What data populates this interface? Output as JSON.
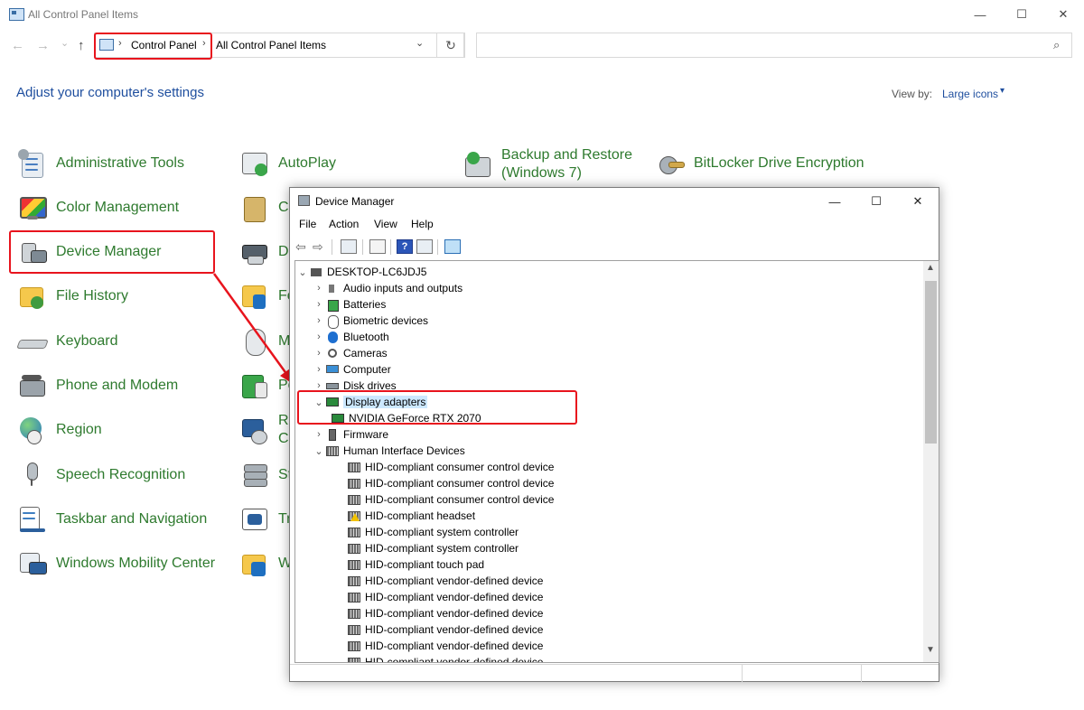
{
  "window": {
    "title": "All Control Panel Items",
    "minimize": "—",
    "maximize": "☐",
    "close": "✕"
  },
  "address": {
    "crumbs": [
      "Control Panel",
      "All Control Panel Items"
    ],
    "separator": "›",
    "dropdown": "⌄",
    "refresh": "↻",
    "search_placeholder": ""
  },
  "nav": {
    "back": "←",
    "forward": "→",
    "recent": "⌄",
    "up": "↑"
  },
  "heading": "Adjust your computer's settings",
  "view_by": {
    "label": "View by:",
    "value": "Large icons",
    "caret": "▾"
  },
  "items": {
    "col1": [
      "Administrative Tools",
      "Color Management",
      "Device Manager",
      "File History",
      "Keyboard",
      "Phone and Modem",
      "Region",
      "Speech Recognition",
      "Taskbar and Navigation",
      "Windows Mobility Center"
    ],
    "col2": [
      "AutoPlay",
      "C",
      "D",
      "Fo",
      "M",
      "Po",
      "Re",
      "St",
      "Tr",
      "W"
    ],
    "col2_line2": {
      "r": "C"
    },
    "backup_line1": "Backup and Restore",
    "backup_line2": "(Windows 7)",
    "bitlocker": "BitLocker Drive Encryption"
  },
  "device_manager": {
    "title": "Device Manager",
    "menus": [
      "File",
      "Action",
      "View",
      "Help"
    ],
    "root": "DESKTOP-LC6JDJ5",
    "categories": [
      "Audio inputs and outputs",
      "Batteries",
      "Biometric devices",
      "Bluetooth",
      "Cameras",
      "Computer",
      "Disk drives",
      "Display adapters",
      "NVIDIA GeForce RTX 2070",
      "Firmware",
      "Human Interface Devices"
    ],
    "hid_devices": [
      "HID-compliant consumer control device",
      "HID-compliant consumer control device",
      "HID-compliant consumer control device",
      "HID-compliant headset",
      "HID-compliant system controller",
      "HID-compliant system controller",
      "HID-compliant touch pad",
      "HID-compliant vendor-defined device",
      "HID-compliant vendor-defined device",
      "HID-compliant vendor-defined device",
      "HID-compliant vendor-defined device",
      "HID-compliant vendor-defined device",
      "HID-compliant vendor-defined device"
    ],
    "expanded_glyph": "⌄",
    "collapsed_glyph": "›"
  },
  "colors": {
    "link_green": "#2e7a2e",
    "heading_blue": "#1e4e9e",
    "annotation_red": "#e8141d",
    "selection": "#cce8ff"
  }
}
